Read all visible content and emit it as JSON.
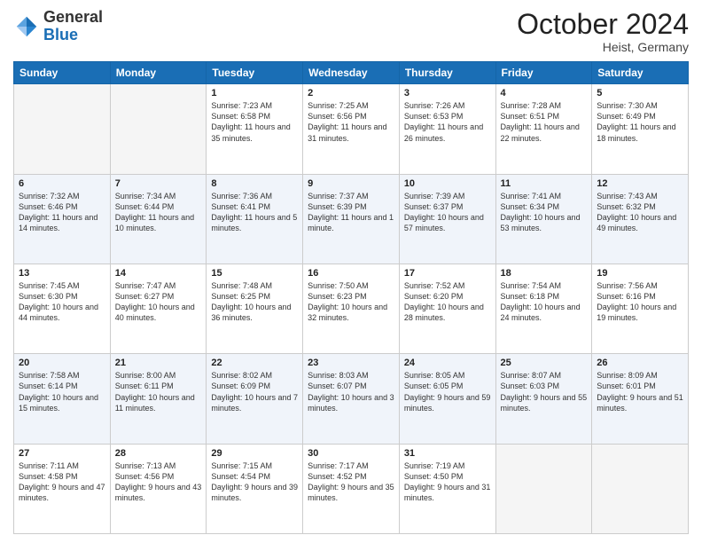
{
  "logo": {
    "general": "General",
    "blue": "Blue"
  },
  "title": "October 2024",
  "location": "Heist, Germany",
  "days_of_week": [
    "Sunday",
    "Monday",
    "Tuesday",
    "Wednesday",
    "Thursday",
    "Friday",
    "Saturday"
  ],
  "weeks": [
    [
      {
        "day": "",
        "empty": true
      },
      {
        "day": "",
        "empty": true
      },
      {
        "day": "1",
        "sunrise": "7:23 AM",
        "sunset": "6:58 PM",
        "daylight": "11 hours and 35 minutes."
      },
      {
        "day": "2",
        "sunrise": "7:25 AM",
        "sunset": "6:56 PM",
        "daylight": "11 hours and 31 minutes."
      },
      {
        "day": "3",
        "sunrise": "7:26 AM",
        "sunset": "6:53 PM",
        "daylight": "11 hours and 26 minutes."
      },
      {
        "day": "4",
        "sunrise": "7:28 AM",
        "sunset": "6:51 PM",
        "daylight": "11 hours and 22 minutes."
      },
      {
        "day": "5",
        "sunrise": "7:30 AM",
        "sunset": "6:49 PM",
        "daylight": "11 hours and 18 minutes."
      }
    ],
    [
      {
        "day": "6",
        "sunrise": "7:32 AM",
        "sunset": "6:46 PM",
        "daylight": "11 hours and 14 minutes."
      },
      {
        "day": "7",
        "sunrise": "7:34 AM",
        "sunset": "6:44 PM",
        "daylight": "11 hours and 10 minutes."
      },
      {
        "day": "8",
        "sunrise": "7:36 AM",
        "sunset": "6:41 PM",
        "daylight": "11 hours and 5 minutes."
      },
      {
        "day": "9",
        "sunrise": "7:37 AM",
        "sunset": "6:39 PM",
        "daylight": "11 hours and 1 minute."
      },
      {
        "day": "10",
        "sunrise": "7:39 AM",
        "sunset": "6:37 PM",
        "daylight": "10 hours and 57 minutes."
      },
      {
        "day": "11",
        "sunrise": "7:41 AM",
        "sunset": "6:34 PM",
        "daylight": "10 hours and 53 minutes."
      },
      {
        "day": "12",
        "sunrise": "7:43 AM",
        "sunset": "6:32 PM",
        "daylight": "10 hours and 49 minutes."
      }
    ],
    [
      {
        "day": "13",
        "sunrise": "7:45 AM",
        "sunset": "6:30 PM",
        "daylight": "10 hours and 44 minutes."
      },
      {
        "day": "14",
        "sunrise": "7:47 AM",
        "sunset": "6:27 PM",
        "daylight": "10 hours and 40 minutes."
      },
      {
        "day": "15",
        "sunrise": "7:48 AM",
        "sunset": "6:25 PM",
        "daylight": "10 hours and 36 minutes."
      },
      {
        "day": "16",
        "sunrise": "7:50 AM",
        "sunset": "6:23 PM",
        "daylight": "10 hours and 32 minutes."
      },
      {
        "day": "17",
        "sunrise": "7:52 AM",
        "sunset": "6:20 PM",
        "daylight": "10 hours and 28 minutes."
      },
      {
        "day": "18",
        "sunrise": "7:54 AM",
        "sunset": "6:18 PM",
        "daylight": "10 hours and 24 minutes."
      },
      {
        "day": "19",
        "sunrise": "7:56 AM",
        "sunset": "6:16 PM",
        "daylight": "10 hours and 19 minutes."
      }
    ],
    [
      {
        "day": "20",
        "sunrise": "7:58 AM",
        "sunset": "6:14 PM",
        "daylight": "10 hours and 15 minutes."
      },
      {
        "day": "21",
        "sunrise": "8:00 AM",
        "sunset": "6:11 PM",
        "daylight": "10 hours and 11 minutes."
      },
      {
        "day": "22",
        "sunrise": "8:02 AM",
        "sunset": "6:09 PM",
        "daylight": "10 hours and 7 minutes."
      },
      {
        "day": "23",
        "sunrise": "8:03 AM",
        "sunset": "6:07 PM",
        "daylight": "10 hours and 3 minutes."
      },
      {
        "day": "24",
        "sunrise": "8:05 AM",
        "sunset": "6:05 PM",
        "daylight": "9 hours and 59 minutes."
      },
      {
        "day": "25",
        "sunrise": "8:07 AM",
        "sunset": "6:03 PM",
        "daylight": "9 hours and 55 minutes."
      },
      {
        "day": "26",
        "sunrise": "8:09 AM",
        "sunset": "6:01 PM",
        "daylight": "9 hours and 51 minutes."
      }
    ],
    [
      {
        "day": "27",
        "sunrise": "7:11 AM",
        "sunset": "4:58 PM",
        "daylight": "9 hours and 47 minutes."
      },
      {
        "day": "28",
        "sunrise": "7:13 AM",
        "sunset": "4:56 PM",
        "daylight": "9 hours and 43 minutes."
      },
      {
        "day": "29",
        "sunrise": "7:15 AM",
        "sunset": "4:54 PM",
        "daylight": "9 hours and 39 minutes."
      },
      {
        "day": "30",
        "sunrise": "7:17 AM",
        "sunset": "4:52 PM",
        "daylight": "9 hours and 35 minutes."
      },
      {
        "day": "31",
        "sunrise": "7:19 AM",
        "sunset": "4:50 PM",
        "daylight": "9 hours and 31 minutes."
      },
      {
        "day": "",
        "empty": true
      },
      {
        "day": "",
        "empty": true
      }
    ]
  ],
  "labels": {
    "sunrise_prefix": "Sunrise: ",
    "sunset_prefix": "Sunset: ",
    "daylight_prefix": "Daylight: "
  }
}
